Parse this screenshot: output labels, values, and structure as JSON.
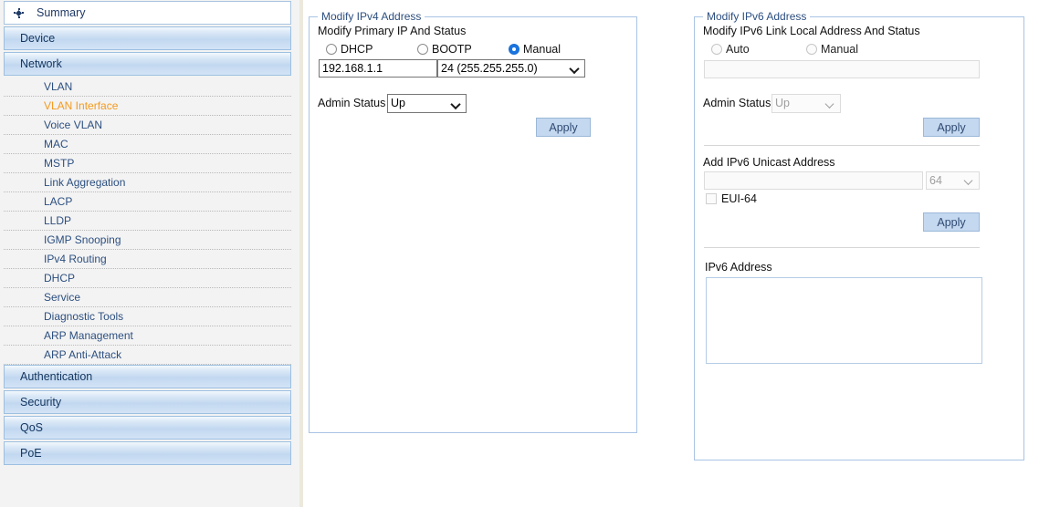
{
  "sidebar": {
    "top_item": {
      "label": "Summary",
      "icon": "diamond-icon"
    },
    "sections": [
      {
        "label": "Device",
        "expanded": false,
        "items": []
      },
      {
        "label": "Network",
        "expanded": true,
        "items": [
          {
            "label": "VLAN",
            "selected": false
          },
          {
            "label": "VLAN Interface",
            "selected": true
          },
          {
            "label": "Voice VLAN",
            "selected": false
          },
          {
            "label": "MAC",
            "selected": false
          },
          {
            "label": "MSTP",
            "selected": false
          },
          {
            "label": "Link Aggregation",
            "selected": false
          },
          {
            "label": "LACP",
            "selected": false
          },
          {
            "label": "LLDP",
            "selected": false
          },
          {
            "label": "IGMP Snooping",
            "selected": false
          },
          {
            "label": "IPv4 Routing",
            "selected": false
          },
          {
            "label": "DHCP",
            "selected": false
          },
          {
            "label": "Service",
            "selected": false
          },
          {
            "label": "Diagnostic Tools",
            "selected": false
          },
          {
            "label": "ARP Management",
            "selected": false
          },
          {
            "label": "ARP Anti-Attack",
            "selected": false
          }
        ]
      },
      {
        "label": "Authentication",
        "expanded": false,
        "items": []
      },
      {
        "label": "Security",
        "expanded": false,
        "items": []
      },
      {
        "label": "QoS",
        "expanded": false,
        "items": []
      },
      {
        "label": "PoE",
        "expanded": false,
        "items": []
      }
    ],
    "selected_color": "#f59a1e",
    "link_color": "#2c4f80"
  },
  "ipv4_panel": {
    "legend": "Modify IPv4 Address",
    "title": "Modify Primary IP And Status",
    "mode_options": [
      {
        "label": "DHCP",
        "selected": false
      },
      {
        "label": "BOOTP",
        "selected": false
      },
      {
        "label": "Manual",
        "selected": true
      }
    ],
    "ip_value": "192.168.1.1",
    "ip_placeholder": "",
    "mask_value": "24 (255.255.255.0)",
    "admin_status_label": "Admin Status",
    "admin_status_value": "Up",
    "apply_label": "Apply"
  },
  "ipv6_panel": {
    "legend": "Modify IPv6 Address",
    "link_local": {
      "title": "Modify IPv6 Link Local Address And Status",
      "mode_options": [
        {
          "label": "Auto",
          "selected": false
        },
        {
          "label": "Manual",
          "selected": false
        }
      ],
      "address_value": "",
      "address_placeholder": "",
      "admin_status_label": "Admin Status",
      "admin_status_value": "Up",
      "apply_label": "Apply"
    },
    "unicast": {
      "title": "Add IPv6 Unicast Address",
      "address_value": "",
      "address_placeholder": "",
      "prefix_value": "64",
      "eui64_label": "EUI-64",
      "eui64_checked": false,
      "apply_label": "Apply"
    },
    "address_list": {
      "title": "IPv6 Address",
      "entries": []
    }
  },
  "colors": {
    "accent_blue": "#1a75e0",
    "panel_border": "#a9c4e4",
    "apply_bg": "#c4d8f0",
    "selected_nav": "#f59a1e",
    "sidebar_bg": "#f3f3f3",
    "divider": "#ece8dc"
  }
}
